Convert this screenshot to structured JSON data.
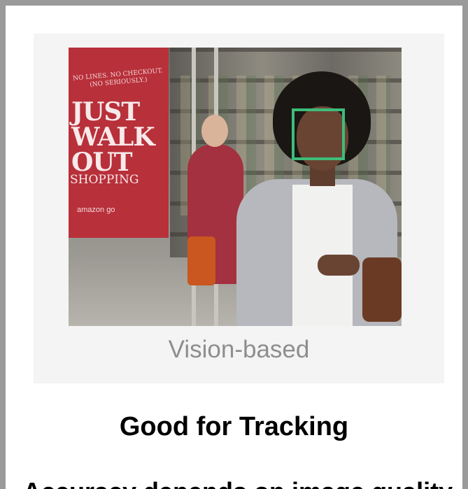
{
  "photo": {
    "sign": {
      "top_lines": [
        "NO LINES. NO CHECKOUT.",
        "(NO SERIOUSLY.)"
      ],
      "main_lines": [
        "JUST",
        "WALK",
        "OUT"
      ],
      "sub": "SHOPPING",
      "brand": "amazon go"
    },
    "box_color": "#3dbc7a"
  },
  "caption": "Vision-based",
  "heading": "Good for Tracking",
  "footer_clipped": "Accuracy depends on image quality"
}
